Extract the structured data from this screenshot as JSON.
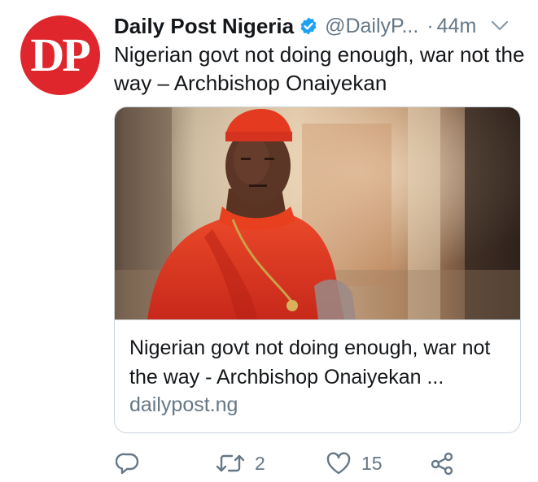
{
  "tweet": {
    "avatar": {
      "text": "DP",
      "color": "#e0262d"
    },
    "author": {
      "name": "Daily Post Nigeria",
      "handle": "@DailyP...",
      "separator": "·",
      "time": "44m",
      "verified": true
    },
    "text": "Nigerian govt not doing enough, war not the way – Archbishop Onaiyekan",
    "card": {
      "image_subject": "Cardinal in red vestments and zucchetto",
      "title": "Nigerian govt not doing enough, war not the way - Archbishop Onaiyekan ...",
      "domain": "dailypost.ng"
    },
    "actions": {
      "reply_icon": "reply-icon",
      "retweet_icon": "retweet-icon",
      "retweet_count": "2",
      "like_icon": "heart-icon",
      "like_count": "15",
      "share_icon": "share-icon"
    },
    "colors": {
      "text": "#14171a",
      "secondary": "#657786",
      "verified": "#1da1f2",
      "border": "#ccd6dd"
    }
  }
}
